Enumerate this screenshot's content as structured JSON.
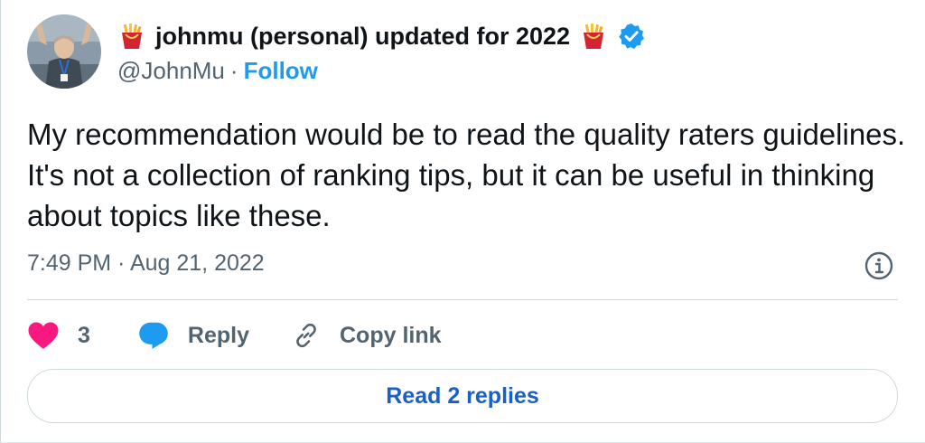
{
  "author": {
    "display_name": "johnmu (personal) updated for 2022",
    "handle": "@JohnMu",
    "separator": "·",
    "follow_label": "Follow",
    "verified": true,
    "name_emoji": "fries-icon"
  },
  "tweet": {
    "text": "My recommendation would be to read the quality raters guidelines. It's not a collection of ranking tips, but it can be useful in thinking about topics like these.",
    "timestamp": "7:49 PM · Aug 21, 2022"
  },
  "actions": {
    "like_count": "3",
    "reply_label": "Reply",
    "copy_link_label": "Copy link"
  },
  "read_replies_label": "Read 2 replies",
  "colors": {
    "link_blue": "#1d9bf0",
    "like_pink": "#f91880",
    "secondary_text": "#536471",
    "button_text": "#1a5ec8"
  }
}
